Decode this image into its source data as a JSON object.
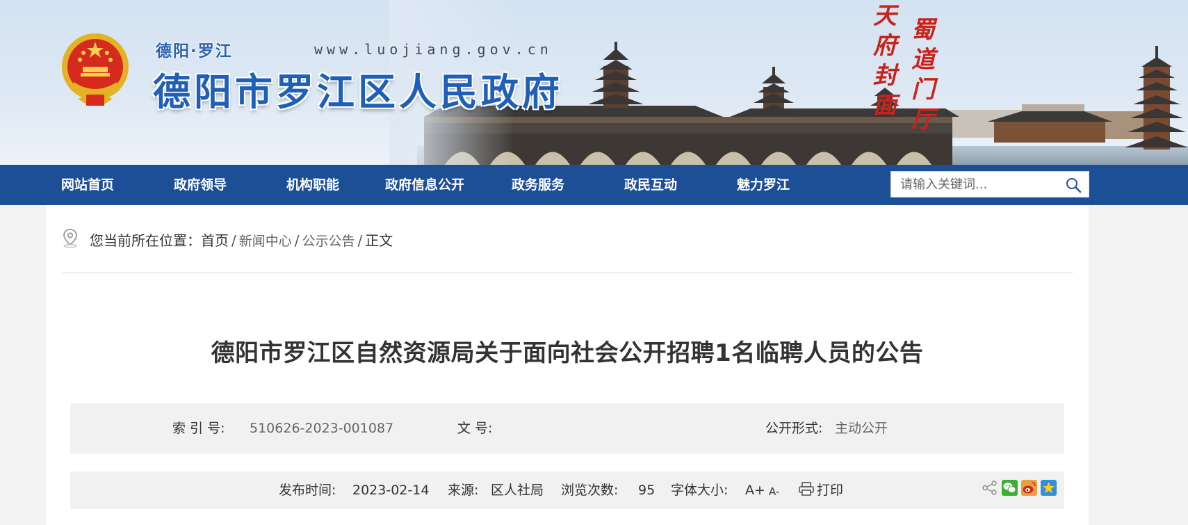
{
  "header": {
    "site_subtitle": "德阳·罗江",
    "site_url": "www.luojiang.gov.cn",
    "site_title": "德阳市罗江区人民政府",
    "calligraphy_left": "天府封面",
    "calligraphy_right": "蜀道门厅",
    "brand_color": "#1d4f96"
  },
  "nav": {
    "items": [
      "网站首页",
      "政府领导",
      "机构职能",
      "政府信息公开",
      "政务服务",
      "政民互动",
      "魅力罗江"
    ],
    "search_placeholder": "请输入关键词..."
  },
  "breadcrumb": {
    "label": "您当前所在位置：",
    "home": "首页",
    "sep": "/",
    "items": [
      "新闻中心",
      "公示公告"
    ],
    "current": "正文"
  },
  "article": {
    "title": "德阳市罗江区自然资源局关于面向社会公开招聘1名临聘人员的公告",
    "index_label": "索 引 号:",
    "index_value": "510626-2023-001087",
    "doc_label": "文 号:",
    "doc_value": "",
    "open_label": "公开形式:",
    "open_value": "主动公开",
    "publish_label": "发布时间:",
    "publish_value": "2023-02-14",
    "source_label": "来源:",
    "source_value": "区人社局",
    "views_label": "浏览次数:",
    "views_value": "95",
    "font_label": "字体大小:",
    "font_up": "A+",
    "font_down": "A-",
    "print_label": "打印"
  },
  "icons": {
    "location": "location-pin-icon",
    "search": "search-icon",
    "print": "printer-icon",
    "share": [
      "share-icon",
      "wechat-icon",
      "weibo-icon",
      "qzone-icon"
    ]
  }
}
